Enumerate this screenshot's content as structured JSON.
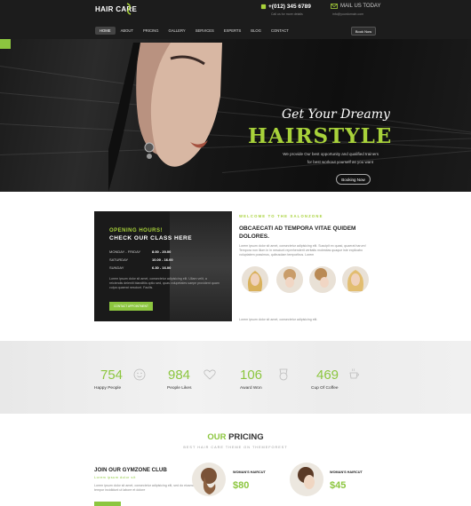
{
  "header": {
    "logo": "HAIR CARE",
    "phone": "+(012) 345 6789",
    "phone_sub": "Call us for more details",
    "mail": "MAIL US TODAY",
    "mail_sub": "info@yourdomain.com",
    "nav": [
      "HOME",
      "ABOUT",
      "PRICING",
      "GALLERY",
      "SERVICES",
      "EXPERTS",
      "BLOG",
      "CONTACT"
    ],
    "book_label": "Book Now"
  },
  "hero": {
    "title1": "Get Your Dreamy",
    "title2": "HAIRSTYLE",
    "text1": "We provide Our best opportunity and qualified trainers",
    "text2": "for best workout yourself as you want",
    "button": "Booking Now"
  },
  "hours": {
    "title1": "OPENING HOURS!",
    "title2": "CHECK OUR CLASS HERE",
    "rows": [
      {
        "day": "MONDAY - FRIDAY",
        "time": "8.00 - 20.00"
      },
      {
        "day": "SATURDAY",
        "time": "10.00 - 16.00"
      },
      {
        "day": "SUNDAY",
        "time": "6.30 - 16.00"
      }
    ],
    "text": "Lorem ipsum dolor sit amet, consectetur adipisicing elit. Ullam velit, a reiciendis deleniti blanditiis optio sed, quas volupetates saepe provident quam culpa quaerat nesciunt. Facilis.",
    "button": "CONTACT APPOINTMENT"
  },
  "about": {
    "welcome": "WELCOME TO THE SALONZONE",
    "title": "OBCAECATI AD TEMPORA VITAE QUIDEM DOLORES.",
    "text": "Lorem ipsum dolor sit amet, consectetur adipisicing elit. Suscipit ex quasi, quaerat harum! Tempora non illum in in nesciunt reprehenderit veritatis molestias quaque iste explicabo voluptatem possimus, quibusdam temporibus. Lorem",
    "bottom": "Lorem ipsum dolor sit amet, consectetur adipisicing elit."
  },
  "stats": [
    {
      "num": "754",
      "label": "Happy People",
      "icon": "smile-icon"
    },
    {
      "num": "984",
      "label": "People Likes",
      "icon": "heart-icon"
    },
    {
      "num": "106",
      "label": "Award Won",
      "icon": "award-icon"
    },
    {
      "num": "469",
      "label": "Cup Of Coffee",
      "icon": "coffee-icon"
    }
  ],
  "pricing": {
    "title_green": "OUR",
    "title_rest": " PRICING",
    "subtitle": "BEST HAIR CARE THEME ON THEMEFOREST",
    "join_title": "JOIN OUR GYMZONE CLUB",
    "join_sub": "Lorem ipsum dolor sit",
    "join_text": "Lorem ipsum dolor sit amet, consectetur adipisicing elit, sed do eiusmod tempor incididunt ut labore et dolore",
    "plans": [
      {
        "label": "WOMAN'S HAIRCUT",
        "price": "$80"
      },
      {
        "label": "WOMAN'S HAIRCUT",
        "price": "$45"
      }
    ]
  },
  "colors": {
    "accent": "#8cc63f",
    "dark": "#1c1c1c"
  }
}
